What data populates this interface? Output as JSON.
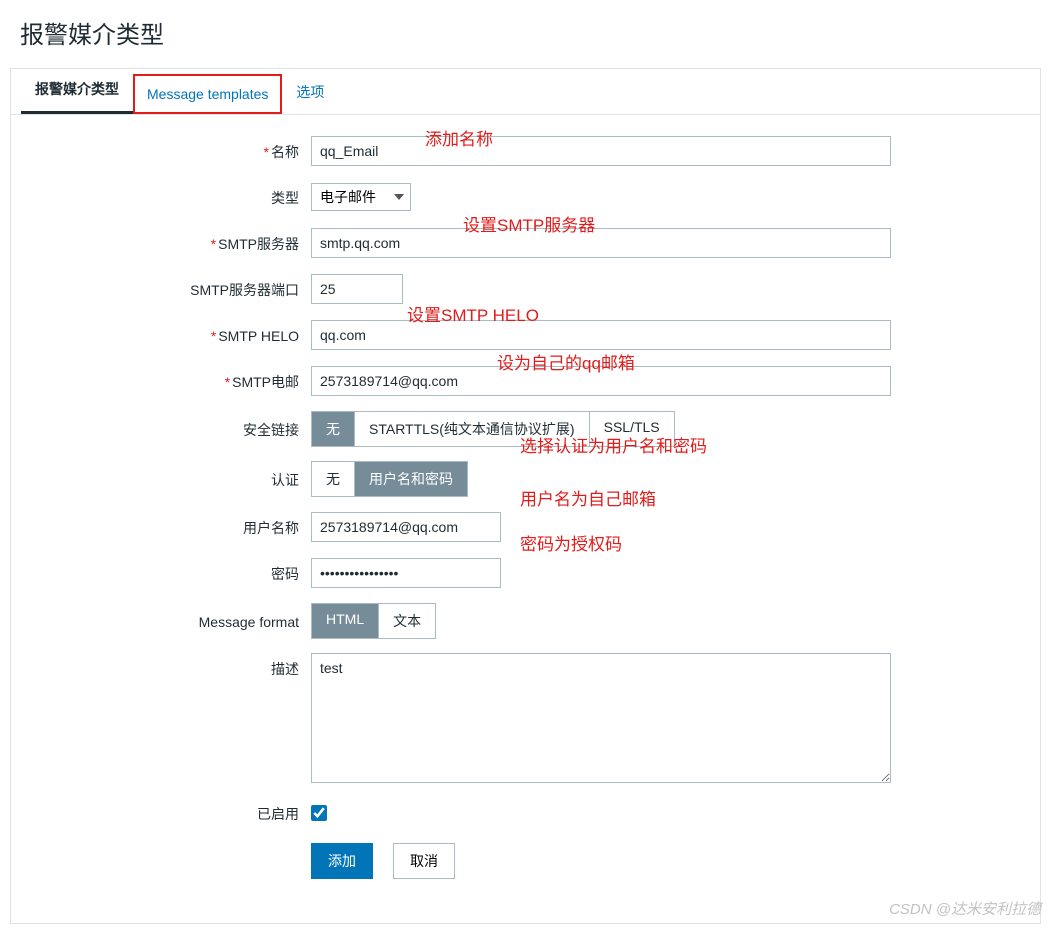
{
  "page_title": "报警媒介类型",
  "tabs": {
    "t0": "报警媒介类型",
    "t1": "Message templates",
    "t2": "选项"
  },
  "labels": {
    "name": "名称",
    "type": "类型",
    "smtp_server": "SMTP服务器",
    "smtp_port": "SMTP服务器端口",
    "smtp_helo": "SMTP HELO",
    "smtp_email": "SMTP电邮",
    "security": "安全链接",
    "auth": "认证",
    "username": "用户名称",
    "password": "密码",
    "msg_format": "Message format",
    "description": "描述",
    "enabled": "已启用"
  },
  "values": {
    "name": "qq_Email",
    "type_option": "电子邮件",
    "smtp_server": "smtp.qq.com",
    "smtp_port": "25",
    "smtp_helo": "qq.com",
    "smtp_email": "2573189714@qq.com",
    "username": "2573189714@qq.com",
    "password": "••••••••••••••••",
    "description": "test"
  },
  "security_opts": {
    "none": "无",
    "starttls": "STARTTLS(纯文本通信协议扩展)",
    "ssl": "SSL/TLS"
  },
  "auth_opts": {
    "none": "无",
    "userpass": "用户名和密码"
  },
  "format_opts": {
    "html": "HTML",
    "text": "文本"
  },
  "buttons": {
    "add": "添加",
    "cancel": "取消"
  },
  "annotations": {
    "a_name": "添加名称",
    "a_smtp": "设置SMTP服务器",
    "a_helo": "设置SMTP HELO",
    "a_email": "设为自己的qq邮箱",
    "a_auth": "选择认证为用户名和密码",
    "a_user": "用户名为自己邮箱",
    "a_pass": "密码为授权码"
  },
  "watermark": "CSDN @达米安利拉德"
}
